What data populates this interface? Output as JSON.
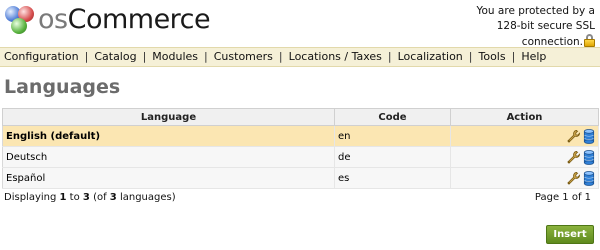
{
  "header": {
    "logo_prefix": "os",
    "logo_main": "Commerce",
    "ssl_notice_line1": "You are protected by a",
    "ssl_notice_line2": "128-bit secure SSL",
    "ssl_notice_line3": "connection."
  },
  "menu": {
    "items": [
      {
        "label": "Configuration"
      },
      {
        "label": "Catalog"
      },
      {
        "label": "Modules"
      },
      {
        "label": "Customers"
      },
      {
        "label": "Locations / Taxes"
      },
      {
        "label": "Localization"
      },
      {
        "label": "Tools"
      },
      {
        "label": "Help"
      }
    ],
    "separator": "|"
  },
  "page": {
    "title": "Languages"
  },
  "table": {
    "columns": {
      "language": "Language",
      "code": "Code",
      "action": "Action"
    },
    "rows": [
      {
        "language": "English (default)",
        "code": "en",
        "selected": true
      },
      {
        "language": "Deutsch",
        "code": "de",
        "selected": false
      },
      {
        "language": "Español",
        "code": "es",
        "selected": false
      }
    ]
  },
  "pagination": {
    "prefix": "Displaying",
    "from": "1",
    "to_word": "to",
    "to": "3",
    "of_prefix": "(of",
    "total": "3",
    "suffix": "languages)",
    "page_text": "Page 1 of 1"
  },
  "actions": {
    "insert_label": "Insert"
  },
  "colors": {
    "menu_bg": "#f5f0d7",
    "selected_row": "#fbe6b2",
    "insert_button": "#6b9626"
  }
}
